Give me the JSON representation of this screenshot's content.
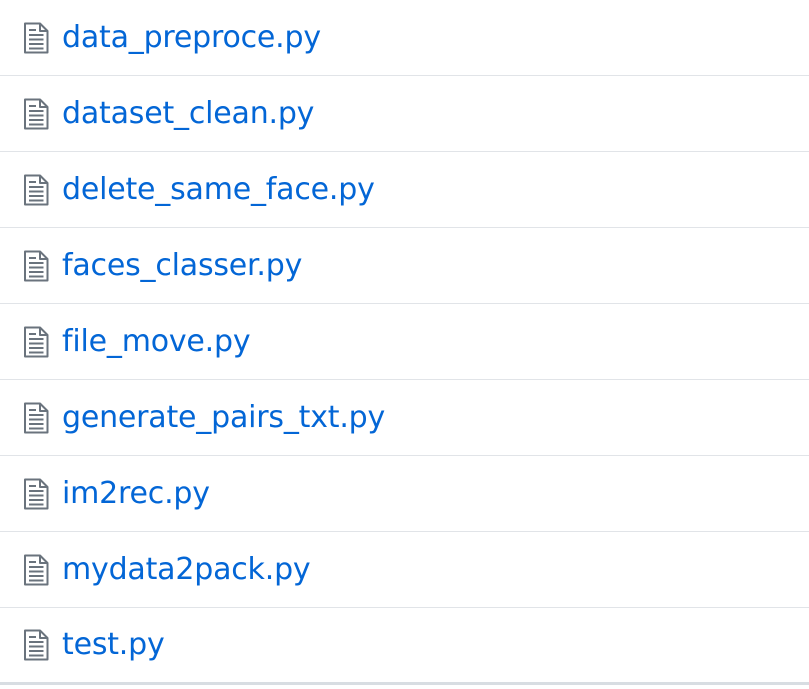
{
  "file_list": {
    "icon": "file-text-icon",
    "colors": {
      "link": "#0366d6",
      "icon": "#6a737d",
      "divider": "#e1e4e8"
    },
    "files": [
      {
        "name": "data_preproce.py"
      },
      {
        "name": "dataset_clean.py"
      },
      {
        "name": "delete_same_face.py"
      },
      {
        "name": "faces_classer.py"
      },
      {
        "name": "file_move.py"
      },
      {
        "name": "generate_pairs_txt.py"
      },
      {
        "name": "im2rec.py"
      },
      {
        "name": "mydata2pack.py"
      },
      {
        "name": "test.py"
      }
    ]
  }
}
